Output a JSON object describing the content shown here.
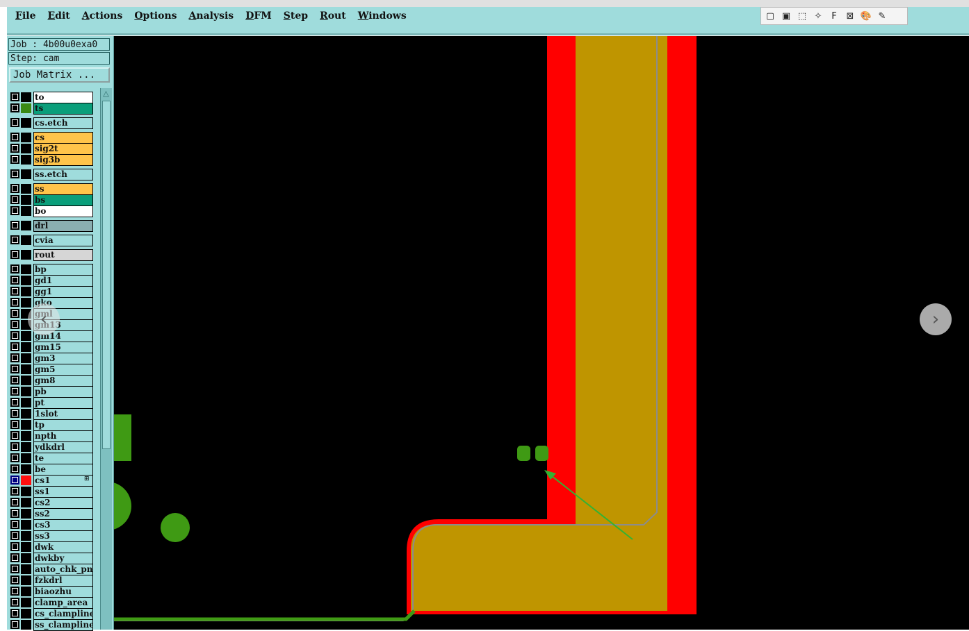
{
  "menubar": {
    "items": [
      {
        "label": "File",
        "u": "F",
        "rest": "ile"
      },
      {
        "label": "Edit",
        "u": "E",
        "rest": "dit"
      },
      {
        "label": "Actions",
        "u": "A",
        "rest": "ctions"
      },
      {
        "label": "Options",
        "u": "O",
        "rest": "ptions"
      },
      {
        "label": "Analysis",
        "u": "A",
        "rest": "nalysis"
      },
      {
        "label": "DFM",
        "u": "D",
        "rest": "FM"
      },
      {
        "label": "Step",
        "u": "S",
        "rest": "tep"
      },
      {
        "label": "Rout",
        "u": "R",
        "rest": "out"
      },
      {
        "label": "Windows",
        "u": "W",
        "rest": "indows"
      }
    ]
  },
  "toolbar": {
    "icons": [
      "window-icon",
      "restore-icon",
      "select-rect-icon",
      "star-cursor-icon",
      "f-box-icon",
      "crossed-box-icon",
      "palette-icon",
      "pen-icon"
    ],
    "glyphs": [
      "▢",
      "▣",
      "⬚",
      "✧",
      "F",
      "⊠",
      "🎨",
      "✎"
    ]
  },
  "left_panel": {
    "job_text": "Job : 4b00u0exa0",
    "step_text": "Step: cam",
    "job_matrix_label": "Job Matrix ...",
    "layers": [
      {
        "name": "to",
        "color": "#ffffff",
        "swatch": "#000000"
      },
      {
        "name": "ts",
        "color": "#0a9e7a",
        "swatch": "#3a8a14"
      },
      {
        "name": "cs.etch",
        "color": "#9fdcdc",
        "swatch": "#000000"
      },
      {
        "name": "cs",
        "color": "#ffc44a",
        "swatch": "#000000"
      },
      {
        "name": "sig2t",
        "color": "#ffc44a",
        "swatch": "#000000"
      },
      {
        "name": "sig3b",
        "color": "#ffc44a",
        "swatch": "#000000"
      },
      {
        "name": "ss.etch",
        "color": "#9fdcdc",
        "swatch": "#000000"
      },
      {
        "name": "ss",
        "color": "#ffc44a",
        "swatch": "#000000"
      },
      {
        "name": "bs",
        "color": "#0a9e7a",
        "swatch": "#000000"
      },
      {
        "name": "bo",
        "color": "#ffffff",
        "swatch": "#000000"
      },
      {
        "name": "drl",
        "color": "#8aaeb0",
        "swatch": "#000000"
      },
      {
        "name": "cvia",
        "color": "#9fdcdc",
        "swatch": "#000000"
      },
      {
        "name": "rout",
        "color": "#d6d6d6",
        "swatch": "#000000"
      },
      {
        "name": "bp",
        "color": "#9fdcdc",
        "swatch": "#000000"
      },
      {
        "name": "gd1",
        "color": "#9fdcdc",
        "swatch": "#000000"
      },
      {
        "name": "gg1",
        "color": "#9fdcdc",
        "swatch": "#000000"
      },
      {
        "name": "gko",
        "color": "#9fdcdc",
        "swatch": "#000000"
      },
      {
        "name": "gml",
        "color": "#9fdcdc",
        "swatch": "#000000"
      },
      {
        "name": "gm13",
        "color": "#9fdcdc",
        "swatch": "#000000"
      },
      {
        "name": "gm14",
        "color": "#9fdcdc",
        "swatch": "#000000"
      },
      {
        "name": "gm15",
        "color": "#9fdcdc",
        "swatch": "#000000"
      },
      {
        "name": "gm3",
        "color": "#9fdcdc",
        "swatch": "#000000"
      },
      {
        "name": "gm5",
        "color": "#9fdcdc",
        "swatch": "#000000"
      },
      {
        "name": "gm8",
        "color": "#9fdcdc",
        "swatch": "#000000"
      },
      {
        "name": "pb",
        "color": "#9fdcdc",
        "swatch": "#000000"
      },
      {
        "name": "pt",
        "color": "#9fdcdc",
        "swatch": "#000000"
      },
      {
        "name": "1slot",
        "color": "#9fdcdc",
        "swatch": "#000000"
      },
      {
        "name": "tp",
        "color": "#9fdcdc",
        "swatch": "#000000"
      },
      {
        "name": "npth",
        "color": "#9fdcdc",
        "swatch": "#000000"
      },
      {
        "name": "ydkdrl",
        "color": "#9fdcdc",
        "swatch": "#000000"
      },
      {
        "name": "te",
        "color": "#9fdcdc",
        "swatch": "#000000"
      },
      {
        "name": "be",
        "color": "#9fdcdc",
        "swatch": "#000000"
      },
      {
        "name": "cs1",
        "color": "#9fdcdc",
        "swatch": "#ff1010",
        "selected": true,
        "marker": "⊞"
      },
      {
        "name": "ss1",
        "color": "#9fdcdc",
        "swatch": "#000000"
      },
      {
        "name": "cs2",
        "color": "#9fdcdc",
        "swatch": "#000000"
      },
      {
        "name": "ss2",
        "color": "#9fdcdc",
        "swatch": "#000000"
      },
      {
        "name": "cs3",
        "color": "#9fdcdc",
        "swatch": "#000000"
      },
      {
        "name": "ss3",
        "color": "#9fdcdc",
        "swatch": "#000000"
      },
      {
        "name": "dwk",
        "color": "#9fdcdc",
        "swatch": "#000000"
      },
      {
        "name": "dwkby",
        "color": "#9fdcdc",
        "swatch": "#000000"
      },
      {
        "name": "auto_chk_pnl",
        "color": "#9fdcdc",
        "swatch": "#000000"
      },
      {
        "name": "fzkdrl",
        "color": "#9fdcdc",
        "swatch": "#000000"
      },
      {
        "name": "biaozhu",
        "color": "#9fdcdc",
        "swatch": "#000000"
      },
      {
        "name": "clamp_area",
        "color": "#9fdcdc",
        "swatch": "#000000"
      },
      {
        "name": "cs_clampline",
        "color": "#9fdcdc",
        "swatch": "#000000"
      },
      {
        "name": "ss_clampline",
        "color": "#9fdcdc",
        "swatch": "#000000"
      }
    ]
  },
  "nav": {
    "prev_glyph": "‹",
    "next_glyph": "›"
  },
  "colors": {
    "copper_red": "#ff0000",
    "copper_gold": "#bf9500",
    "pad_green": "#3f9a14",
    "outline_gray": "#8c8c8c",
    "arrow_green": "#33b233"
  }
}
